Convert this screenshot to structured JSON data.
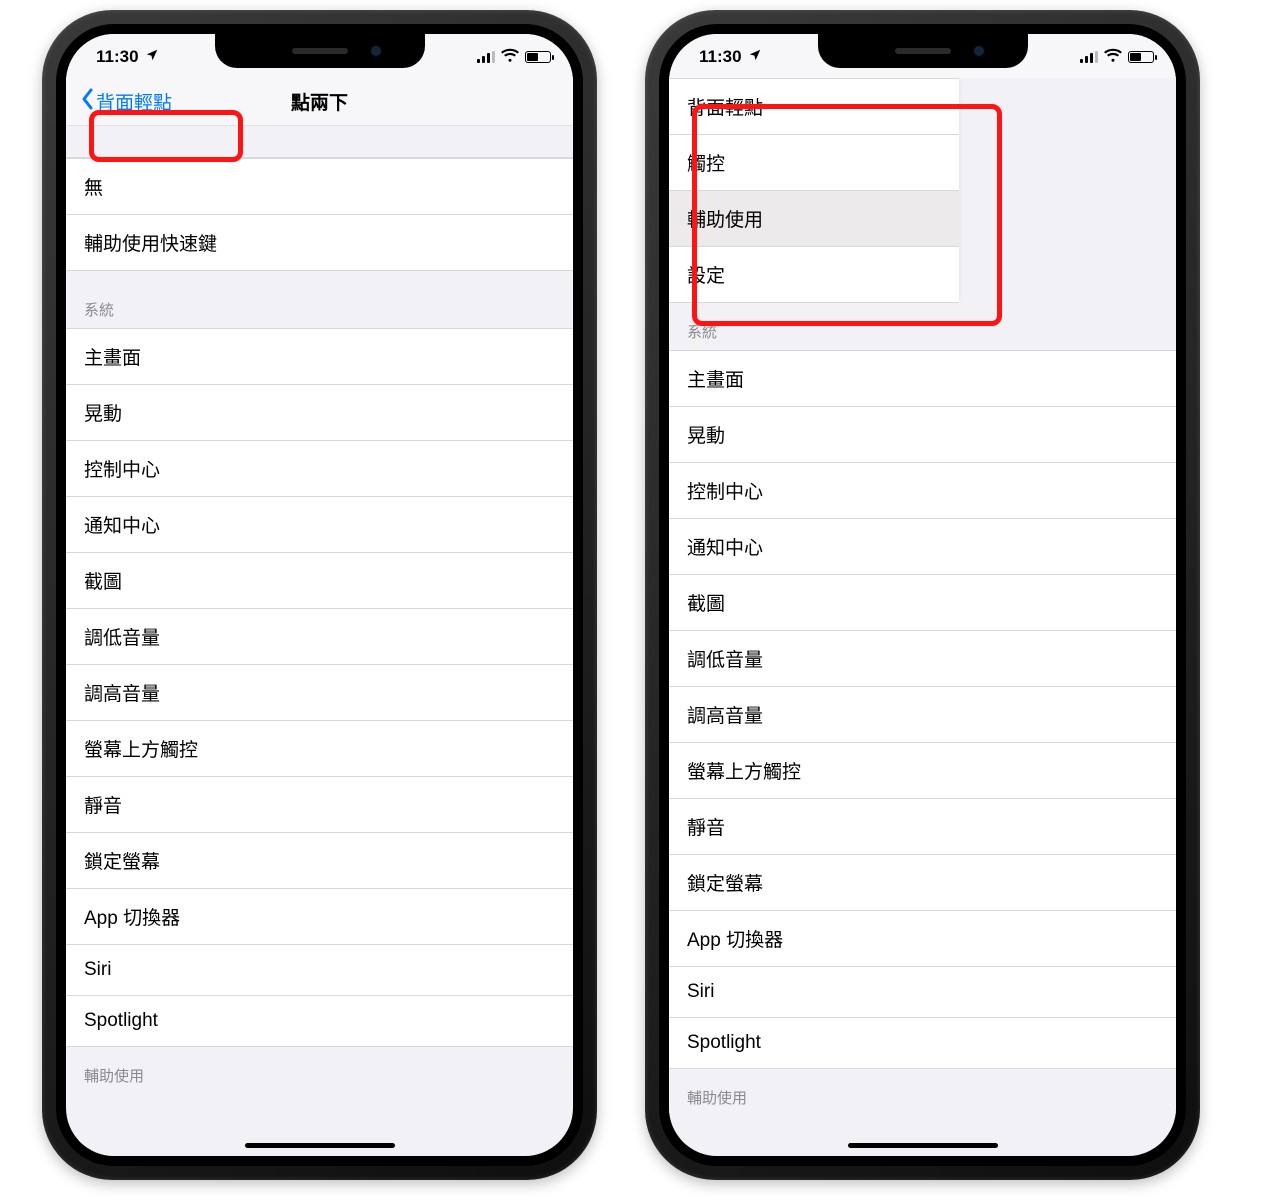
{
  "status": {
    "time": "11:30",
    "location_icon": "location-arrow",
    "signal_label": "cellular-signal",
    "wifi_label": "wifi",
    "battery_label": "battery"
  },
  "left_phone": {
    "nav": {
      "back_label": "背面輕點",
      "title": "點兩下"
    },
    "group1": {
      "items": [
        "無",
        "輔助使用快速鍵"
      ]
    },
    "group2": {
      "header": "系統",
      "items": [
        "主畫面",
        "晃動",
        "控制中心",
        "通知中心",
        "截圖",
        "調低音量",
        "調高音量",
        "螢幕上方觸控",
        "靜音",
        "鎖定螢幕",
        "App 切換器",
        "Siri",
        "Spotlight"
      ]
    },
    "group3": {
      "header": "輔助使用"
    }
  },
  "right_phone": {
    "breadcrumb": {
      "items": [
        "背面輕點",
        "觸控",
        "輔助使用",
        "設定"
      ],
      "highlighted_index": 2
    },
    "group2": {
      "header": "系統",
      "items": [
        "主畫面",
        "晃動",
        "控制中心",
        "通知中心",
        "截圖",
        "調低音量",
        "調高音量",
        "螢幕上方觸控",
        "靜音",
        "鎖定螢幕",
        "App 切換器",
        "Siri",
        "Spotlight"
      ]
    },
    "group3": {
      "header": "輔助使用"
    }
  }
}
